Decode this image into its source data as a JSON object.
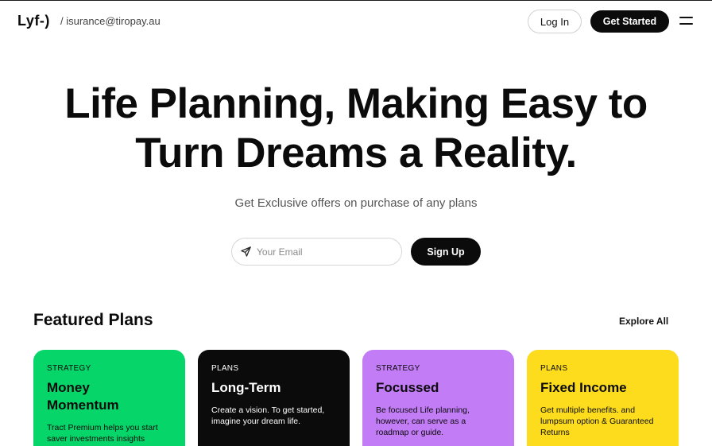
{
  "header": {
    "logo": "Lyf-)",
    "email_crumb": "/ isurance@tiropay.au",
    "login_label": "Log In",
    "get_started_label": "Get Started",
    "menu_icon": "hamburger-menu-icon"
  },
  "hero": {
    "title_line1": "Life Planning, Making Easy to",
    "title_line2": "Turn Dreams a Reality.",
    "subtitle": "Get Exclusive offers on purchase of any plans",
    "email_placeholder": "Your Email",
    "email_icon": "send-icon",
    "signup_label": "Sign Up"
  },
  "featured": {
    "title": "Featured Plans",
    "explore_label": "Explore All",
    "cards": [
      {
        "category": "STRATEGY",
        "name_line1": "Money",
        "name_line2": "Momentum",
        "description": "Tract Premium helps you start saver investments insights",
        "color": "#06d66a"
      },
      {
        "category": "PLANS",
        "name_line1": "Long-Term",
        "name_line2": "",
        "description": "Create a vision. To get started, imagine your dream life.",
        "color": "#0b0b0b"
      },
      {
        "category": "STRATEGY",
        "name_line1": "Focussed",
        "name_line2": "",
        "description": "Be focused Life planning, however, can serve as a roadmap or guide.",
        "color": "#c27cf6"
      },
      {
        "category": "PLANS",
        "name_line1": "Fixed Income",
        "name_line2": "",
        "description": "Get multiple benefits. and lumpsum option & Guaranteed Returns",
        "color": "#fddc1d"
      }
    ]
  }
}
